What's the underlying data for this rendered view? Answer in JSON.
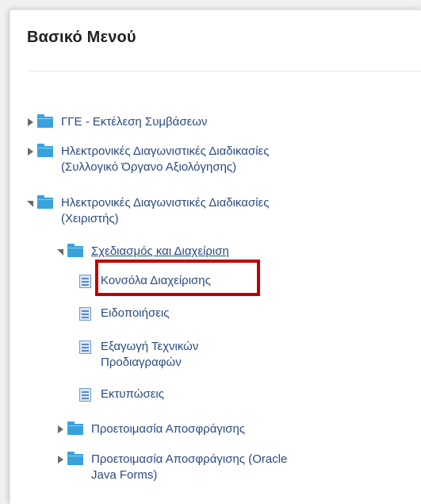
{
  "menu": {
    "title": "Βασικό Μενού",
    "items": [
      {
        "label": "ΓΓΕ - Εκτέλεση Συμβάσεων"
      },
      {
        "label_line1": "Ηλεκτρονικές Διαγωνιστικές Διαδικασίες",
        "label_line2": "(Συλλογικό Όργανο Αξιολόγησης)"
      },
      {
        "label_line1": "Ηλεκτρονικές Διαγωνιστικές Διαδικασίες",
        "label_line2": "(Χειριστής)"
      },
      {
        "label": "Σχεδιασμός και Διαχείριση"
      },
      {
        "label": "Κονσόλα Διαχείρισης"
      },
      {
        "label": "Ειδοποιήσεις"
      },
      {
        "label_line1": "Εξαγωγή Τεχνικών",
        "label_line2": "Προδιαγραφών"
      },
      {
        "label": "Εκτυπώσεις"
      },
      {
        "label": "Προετοιμασία Αποσφράγισης"
      },
      {
        "label_line1": "Προετοιμασία Αποσφράγισης (Oracle",
        "label_line2": "Java Forms)"
      }
    ]
  },
  "colors": {
    "link": "#2a4b82",
    "folder": "#39a2db",
    "highlight": "#c00000"
  },
  "icons": {
    "expand": "triangle-right-icon",
    "collapse": "triangle-down-icon",
    "folder": "folder-icon",
    "document": "document-icon"
  }
}
